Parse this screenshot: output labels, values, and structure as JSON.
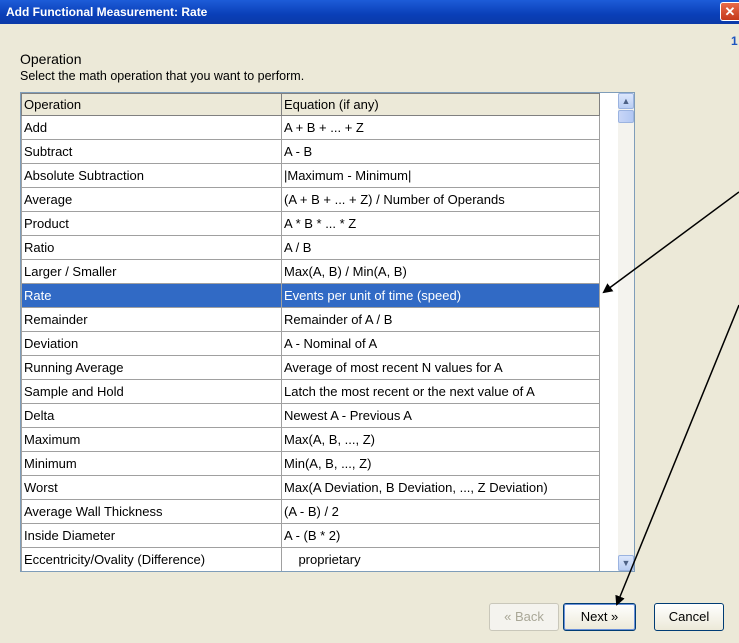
{
  "window": {
    "title": "Add Functional Measurement: Rate",
    "close_symbol": "✕",
    "step_number": "1"
  },
  "section": {
    "title": "Operation",
    "description": "Select the math operation that you want to perform."
  },
  "table": {
    "headers": [
      "Operation",
      "Equation (if any)"
    ],
    "selected_index": 7,
    "rows": [
      {
        "operation": "Add",
        "equation": "A + B + ... + Z"
      },
      {
        "operation": "Subtract",
        "equation": "A - B"
      },
      {
        "operation": "Absolute Subtraction",
        "equation": "|Maximum - Minimum|"
      },
      {
        "operation": "Average",
        "equation": "(A + B + ... + Z) / Number of Operands"
      },
      {
        "operation": "Product",
        "equation": "A * B * ... * Z"
      },
      {
        "operation": "Ratio",
        "equation": "A / B"
      },
      {
        "operation": "Larger / Smaller",
        "equation": "Max(A, B) / Min(A, B)"
      },
      {
        "operation": "Rate",
        "equation": "Events per unit of time (speed)"
      },
      {
        "operation": "Remainder",
        "equation": "Remainder of A / B"
      },
      {
        "operation": "Deviation",
        "equation": "A - Nominal of A"
      },
      {
        "operation": "Running Average",
        "equation": "Average of most recent N values for A"
      },
      {
        "operation": "Sample and Hold",
        "equation": "Latch the most recent or the next value of A"
      },
      {
        "operation": "Delta",
        "equation": "Newest A - Previous A"
      },
      {
        "operation": "Maximum",
        "equation": "Max(A, B, ..., Z)"
      },
      {
        "operation": "Minimum",
        "equation": "Min(A, B, ..., Z)"
      },
      {
        "operation": "Worst",
        "equation": "Max(A Deviation, B Deviation, ..., Z Deviation)"
      },
      {
        "operation": "Average Wall Thickness",
        "equation": "(A - B) / 2"
      },
      {
        "operation": "Inside Diameter",
        "equation": "A - (B * 2)"
      },
      {
        "operation": "Eccentricity/Ovality (Difference)",
        "equation": "    proprietary"
      }
    ]
  },
  "scrollbar": {
    "up_symbol": "▲",
    "down_symbol": "▼"
  },
  "buttons": {
    "back": "« Back",
    "next": "Next »",
    "cancel": "Cancel"
  },
  "colors": {
    "selection": "#316ac5",
    "titlebar": "#0a3fb8",
    "annotation_arrow": "#000000"
  }
}
